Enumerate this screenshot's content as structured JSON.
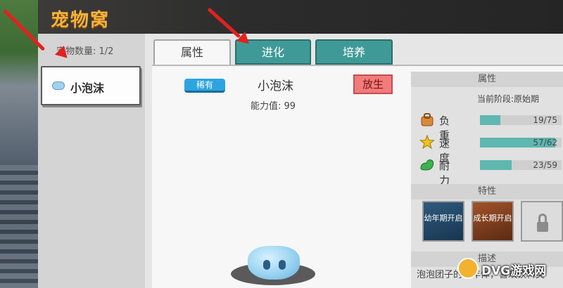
{
  "window": {
    "title": "宠物窝"
  },
  "sidebar": {
    "pet_count": "宠物数量: 1/2",
    "pets": [
      {
        "name": "小泡沫"
      }
    ]
  },
  "tabs": [
    {
      "label": "属性",
      "active": true
    },
    {
      "label": "进化",
      "active": false
    },
    {
      "label": "培养",
      "active": false
    }
  ],
  "pet": {
    "rarity": "稀有",
    "name": "小泡沫",
    "power": "能力值: 99",
    "release_label": "放生"
  },
  "attributes": {
    "section_title": "属性",
    "stage": "当前阶段:原始期",
    "stats": [
      {
        "label": "负重",
        "value": "19/75",
        "fraction": 0.253,
        "icon": "backpack-icon"
      },
      {
        "label": "速度",
        "value": "57/62",
        "fraction": 0.919,
        "icon": "star-speed-icon"
      },
      {
        "label": "耐力",
        "value": "23/59",
        "fraction": 0.39,
        "icon": "muscle-icon"
      }
    ]
  },
  "traits": {
    "section_title": "特性",
    "items": [
      {
        "text": "幼年期开启",
        "icon": "trait-juvenile-icon"
      },
      {
        "text": "成长期开启",
        "icon": "trait-growth-icon"
      },
      {
        "text": "",
        "icon": "lock-icon"
      }
    ]
  },
  "description": {
    "section_title": "描述",
    "text": "泡泡团子的幼年体，喜欢饮料类"
  },
  "watermark": {
    "text": "DVG游戏网"
  },
  "colors": {
    "accent_teal": "#3f9a97",
    "title_orange": "#f6b23c",
    "rarity_blue": "#2da4e0",
    "release_red": "#f07c7c",
    "arrow_red": "#e3211e"
  }
}
